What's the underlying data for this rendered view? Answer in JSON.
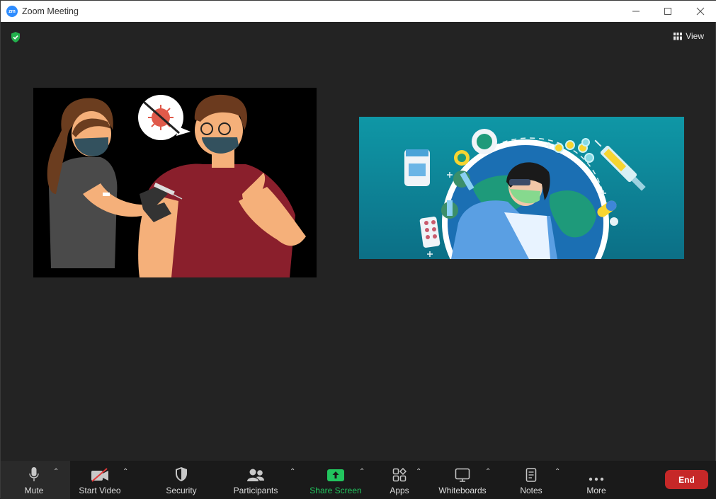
{
  "window": {
    "title": "Zoom Meeting",
    "logo_text": "zm"
  },
  "header": {
    "view_label": "View"
  },
  "toolbar": {
    "mute": "Mute",
    "start_video": "Start Video",
    "security": "Security",
    "participants": "Participants",
    "share_screen": "Share Screen",
    "apps": "Apps",
    "whiteboards": "Whiteboards",
    "notes": "Notes",
    "more": "More",
    "end": "End"
  },
  "colors": {
    "accent_green": "#22c55e",
    "end_red": "#c62828",
    "zoom_blue": "#2d8cff",
    "tile2_bg": "#0d8a9c"
  },
  "icons": [
    "zoom-logo-icon",
    "minimize-icon",
    "maximize-icon",
    "close-icon",
    "encryption-shield-icon",
    "grid-view-icon",
    "microphone-icon",
    "video-off-icon",
    "security-shield-icon",
    "participants-icon",
    "share-screen-icon",
    "apps-icon",
    "whiteboard-icon",
    "notes-icon",
    "more-dots-icon",
    "chevron-up-icon"
  ]
}
